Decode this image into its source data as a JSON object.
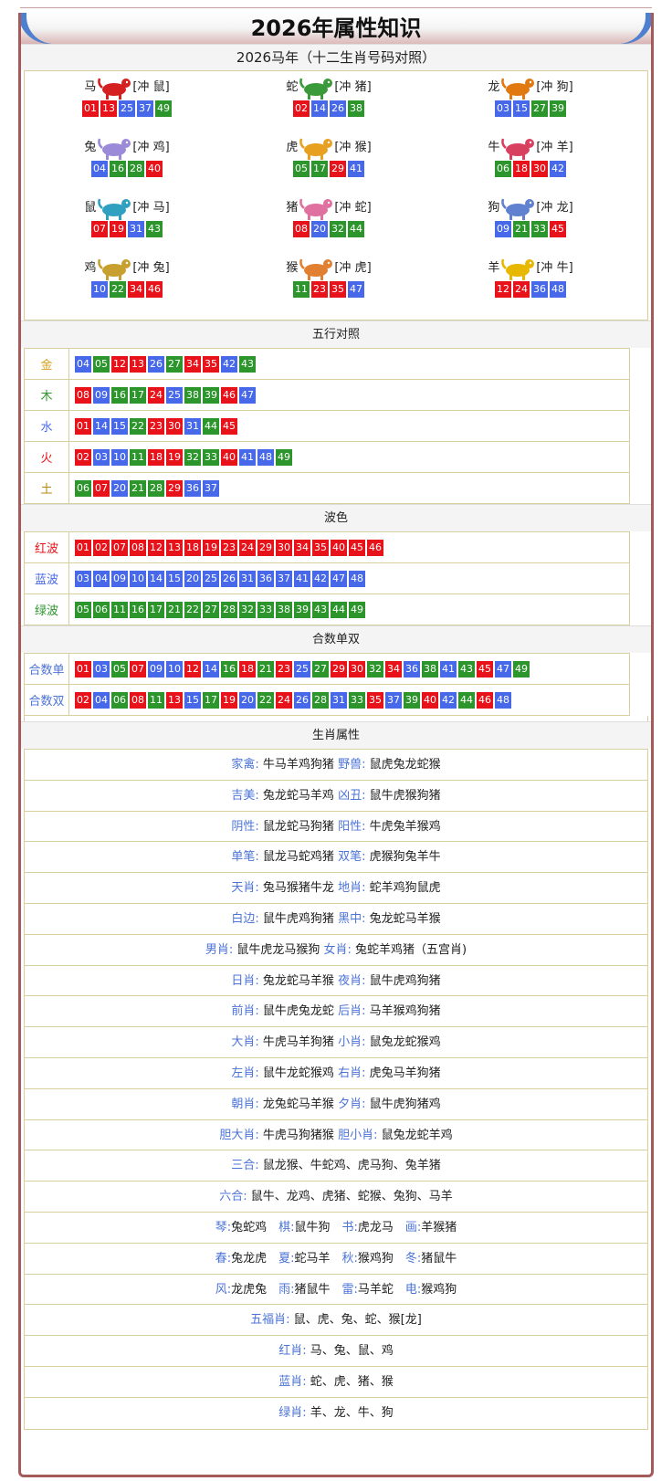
{
  "title": "2026年属性知识",
  "zodiac_section": {
    "heading": "2026马年（十二生肖号码对照）",
    "items": [
      {
        "name": "马",
        "icon": "horse-icon",
        "chong": "[冲 鼠]",
        "nums": [
          [
            "01",
            "red"
          ],
          [
            "13",
            "red"
          ],
          [
            "25",
            "blue"
          ],
          [
            "37",
            "blue"
          ],
          [
            "49",
            "green"
          ]
        ]
      },
      {
        "name": "蛇",
        "icon": "snake-icon",
        "chong": "[冲 猪]",
        "nums": [
          [
            "02",
            "red"
          ],
          [
            "14",
            "blue"
          ],
          [
            "26",
            "blue"
          ],
          [
            "38",
            "green"
          ]
        ]
      },
      {
        "name": "龙",
        "icon": "dragon-icon",
        "chong": "[冲 狗]",
        "nums": [
          [
            "03",
            "blue"
          ],
          [
            "15",
            "blue"
          ],
          [
            "27",
            "green"
          ],
          [
            "39",
            "green"
          ]
        ]
      },
      {
        "name": "兔",
        "icon": "rabbit-icon",
        "chong": "[冲 鸡]",
        "nums": [
          [
            "04",
            "blue"
          ],
          [
            "16",
            "green"
          ],
          [
            "28",
            "green"
          ],
          [
            "40",
            "red"
          ]
        ]
      },
      {
        "name": "虎",
        "icon": "tiger-icon",
        "chong": "[冲 猴]",
        "nums": [
          [
            "05",
            "green"
          ],
          [
            "17",
            "green"
          ],
          [
            "29",
            "red"
          ],
          [
            "41",
            "blue"
          ]
        ]
      },
      {
        "name": "牛",
        "icon": "ox-icon",
        "chong": "[冲 羊]",
        "nums": [
          [
            "06",
            "green"
          ],
          [
            "18",
            "red"
          ],
          [
            "30",
            "red"
          ],
          [
            "42",
            "blue"
          ]
        ]
      },
      {
        "name": "鼠",
        "icon": "rat-icon",
        "chong": "[冲 马]",
        "nums": [
          [
            "07",
            "red"
          ],
          [
            "19",
            "red"
          ],
          [
            "31",
            "blue"
          ],
          [
            "43",
            "green"
          ]
        ]
      },
      {
        "name": "猪",
        "icon": "pig-icon",
        "chong": "[冲 蛇]",
        "nums": [
          [
            "08",
            "red"
          ],
          [
            "20",
            "blue"
          ],
          [
            "32",
            "green"
          ],
          [
            "44",
            "green"
          ]
        ]
      },
      {
        "name": "狗",
        "icon": "dog-icon",
        "chong": "[冲 龙]",
        "nums": [
          [
            "09",
            "blue"
          ],
          [
            "21",
            "green"
          ],
          [
            "33",
            "green"
          ],
          [
            "45",
            "red"
          ]
        ]
      },
      {
        "name": "鸡",
        "icon": "rooster-icon",
        "chong": "[冲 兔]",
        "nums": [
          [
            "10",
            "blue"
          ],
          [
            "22",
            "green"
          ],
          [
            "34",
            "red"
          ],
          [
            "46",
            "red"
          ]
        ]
      },
      {
        "name": "猴",
        "icon": "monkey-icon",
        "chong": "[冲 虎]",
        "nums": [
          [
            "11",
            "green"
          ],
          [
            "23",
            "red"
          ],
          [
            "35",
            "red"
          ],
          [
            "47",
            "blue"
          ]
        ]
      },
      {
        "name": "羊",
        "icon": "goat-icon",
        "chong": "[冲 牛]",
        "nums": [
          [
            "12",
            "red"
          ],
          [
            "24",
            "red"
          ],
          [
            "36",
            "blue"
          ],
          [
            "48",
            "blue"
          ]
        ]
      }
    ]
  },
  "wuxing_section": {
    "heading": "五行对照",
    "rows": [
      {
        "label": "金",
        "color": "#d4a017",
        "nums": [
          [
            "04",
            "blue"
          ],
          [
            "05",
            "green"
          ],
          [
            "12",
            "red"
          ],
          [
            "13",
            "red"
          ],
          [
            "26",
            "blue"
          ],
          [
            "27",
            "green"
          ],
          [
            "34",
            "red"
          ],
          [
            "35",
            "red"
          ],
          [
            "42",
            "blue"
          ],
          [
            "43",
            "green"
          ]
        ]
      },
      {
        "label": "木",
        "color": "#2c952c",
        "nums": [
          [
            "08",
            "red"
          ],
          [
            "09",
            "blue"
          ],
          [
            "16",
            "green"
          ],
          [
            "17",
            "green"
          ],
          [
            "24",
            "red"
          ],
          [
            "25",
            "blue"
          ],
          [
            "38",
            "green"
          ],
          [
            "39",
            "green"
          ],
          [
            "46",
            "red"
          ],
          [
            "47",
            "blue"
          ]
        ]
      },
      {
        "label": "水",
        "color": "#4768e8",
        "nums": [
          [
            "01",
            "red"
          ],
          [
            "14",
            "blue"
          ],
          [
            "15",
            "blue"
          ],
          [
            "22",
            "green"
          ],
          [
            "23",
            "red"
          ],
          [
            "30",
            "red"
          ],
          [
            "31",
            "blue"
          ],
          [
            "44",
            "green"
          ],
          [
            "45",
            "red"
          ]
        ]
      },
      {
        "label": "火",
        "color": "#e8121a",
        "nums": [
          [
            "02",
            "red"
          ],
          [
            "03",
            "blue"
          ],
          [
            "10",
            "blue"
          ],
          [
            "11",
            "green"
          ],
          [
            "18",
            "red"
          ],
          [
            "19",
            "red"
          ],
          [
            "32",
            "green"
          ],
          [
            "33",
            "green"
          ],
          [
            "40",
            "red"
          ],
          [
            "41",
            "blue"
          ],
          [
            "48",
            "blue"
          ],
          [
            "49",
            "green"
          ]
        ]
      },
      {
        "label": "土",
        "color": "#b8860b",
        "nums": [
          [
            "06",
            "green"
          ],
          [
            "07",
            "red"
          ],
          [
            "20",
            "blue"
          ],
          [
            "21",
            "green"
          ],
          [
            "28",
            "green"
          ],
          [
            "29",
            "red"
          ],
          [
            "36",
            "blue"
          ],
          [
            "37",
            "blue"
          ]
        ]
      }
    ]
  },
  "wave_section": {
    "heading": "波色",
    "rows": [
      {
        "label": "红波",
        "color": "#e8121a",
        "nums": [
          [
            "01",
            "red"
          ],
          [
            "02",
            "red"
          ],
          [
            "07",
            "red"
          ],
          [
            "08",
            "red"
          ],
          [
            "12",
            "red"
          ],
          [
            "13",
            "red"
          ],
          [
            "18",
            "red"
          ],
          [
            "19",
            "red"
          ],
          [
            "23",
            "red"
          ],
          [
            "24",
            "red"
          ],
          [
            "29",
            "red"
          ],
          [
            "30",
            "red"
          ],
          [
            "34",
            "red"
          ],
          [
            "35",
            "red"
          ],
          [
            "40",
            "red"
          ],
          [
            "45",
            "red"
          ],
          [
            "46",
            "red"
          ]
        ]
      },
      {
        "label": "蓝波",
        "color": "#4768e8",
        "nums": [
          [
            "03",
            "blue"
          ],
          [
            "04",
            "blue"
          ],
          [
            "09",
            "blue"
          ],
          [
            "10",
            "blue"
          ],
          [
            "14",
            "blue"
          ],
          [
            "15",
            "blue"
          ],
          [
            "20",
            "blue"
          ],
          [
            "25",
            "blue"
          ],
          [
            "26",
            "blue"
          ],
          [
            "31",
            "blue"
          ],
          [
            "36",
            "blue"
          ],
          [
            "37",
            "blue"
          ],
          [
            "41",
            "blue"
          ],
          [
            "42",
            "blue"
          ],
          [
            "47",
            "blue"
          ],
          [
            "48",
            "blue"
          ]
        ]
      },
      {
        "label": "绿波",
        "color": "#2c952c",
        "nums": [
          [
            "05",
            "green"
          ],
          [
            "06",
            "green"
          ],
          [
            "11",
            "green"
          ],
          [
            "16",
            "green"
          ],
          [
            "17",
            "green"
          ],
          [
            "21",
            "green"
          ],
          [
            "22",
            "green"
          ],
          [
            "27",
            "green"
          ],
          [
            "28",
            "green"
          ],
          [
            "32",
            "green"
          ],
          [
            "33",
            "green"
          ],
          [
            "38",
            "green"
          ],
          [
            "39",
            "green"
          ],
          [
            "43",
            "green"
          ],
          [
            "44",
            "green"
          ],
          [
            "49",
            "green"
          ]
        ]
      }
    ]
  },
  "heshu_section": {
    "heading": "合数单双",
    "rows": [
      {
        "label": "合数单",
        "color": "#4b73d8",
        "nums": [
          [
            "01",
            "red"
          ],
          [
            "03",
            "blue"
          ],
          [
            "05",
            "green"
          ],
          [
            "07",
            "red"
          ],
          [
            "09",
            "blue"
          ],
          [
            "10",
            "blue"
          ],
          [
            "12",
            "red"
          ],
          [
            "14",
            "blue"
          ],
          [
            "16",
            "green"
          ],
          [
            "18",
            "red"
          ],
          [
            "21",
            "green"
          ],
          [
            "23",
            "red"
          ],
          [
            "25",
            "blue"
          ],
          [
            "27",
            "green"
          ],
          [
            "29",
            "red"
          ],
          [
            "30",
            "red"
          ],
          [
            "32",
            "green"
          ],
          [
            "34",
            "red"
          ],
          [
            "36",
            "blue"
          ],
          [
            "38",
            "green"
          ],
          [
            "41",
            "blue"
          ],
          [
            "43",
            "green"
          ],
          [
            "45",
            "red"
          ],
          [
            "47",
            "blue"
          ],
          [
            "49",
            "green"
          ]
        ]
      },
      {
        "label": "合数双",
        "color": "#4b73d8",
        "nums": [
          [
            "02",
            "red"
          ],
          [
            "04",
            "blue"
          ],
          [
            "06",
            "green"
          ],
          [
            "08",
            "red"
          ],
          [
            "11",
            "green"
          ],
          [
            "13",
            "red"
          ],
          [
            "15",
            "blue"
          ],
          [
            "17",
            "green"
          ],
          [
            "19",
            "red"
          ],
          [
            "20",
            "blue"
          ],
          [
            "22",
            "green"
          ],
          [
            "24",
            "red"
          ],
          [
            "26",
            "blue"
          ],
          [
            "28",
            "green"
          ],
          [
            "31",
            "blue"
          ],
          [
            "33",
            "green"
          ],
          [
            "35",
            "red"
          ],
          [
            "37",
            "blue"
          ],
          [
            "39",
            "green"
          ],
          [
            "40",
            "red"
          ],
          [
            "42",
            "blue"
          ],
          [
            "44",
            "green"
          ],
          [
            "46",
            "red"
          ],
          [
            "48",
            "blue"
          ]
        ]
      }
    ]
  },
  "attr_section": {
    "heading": "生肖属性",
    "rows": [
      [
        {
          "k": "家禽:",
          "v": " 牛马羊鸡狗猪 "
        },
        {
          "k": "野兽:",
          "v": " 鼠虎兔龙蛇猴"
        }
      ],
      [
        {
          "k": "吉美:",
          "v": " 兔龙蛇马羊鸡 "
        },
        {
          "k": "凶丑:",
          "v": " 鼠牛虎猴狗猪"
        }
      ],
      [
        {
          "k": "阴性:",
          "v": " 鼠龙蛇马狗猪 "
        },
        {
          "k": "阳性:",
          "v": " 牛虎兔羊猴鸡"
        }
      ],
      [
        {
          "k": "单笔:",
          "v": " 鼠龙马蛇鸡猪 "
        },
        {
          "k": "双笔:",
          "v": " 虎猴狗兔羊牛"
        }
      ],
      [
        {
          "k": "天肖:",
          "v": " 兔马猴猪牛龙 "
        },
        {
          "k": "地肖:",
          "v": " 蛇羊鸡狗鼠虎"
        }
      ],
      [
        {
          "k": "白边:",
          "v": " 鼠牛虎鸡狗猪 "
        },
        {
          "k": "黑中:",
          "v": " 兔龙蛇马羊猴"
        }
      ],
      [
        {
          "k": "男肖:",
          "v": " 鼠牛虎龙马猴狗 "
        },
        {
          "k": "女肖:",
          "v": " 兔蛇羊鸡猪（五宫肖)"
        }
      ],
      [
        {
          "k": "日肖:",
          "v": " 兔龙蛇马羊猴 "
        },
        {
          "k": "夜肖:",
          "v": " 鼠牛虎鸡狗猪"
        }
      ],
      [
        {
          "k": "前肖:",
          "v": " 鼠牛虎兔龙蛇 "
        },
        {
          "k": "后肖:",
          "v": " 马羊猴鸡狗猪"
        }
      ],
      [
        {
          "k": "大肖:",
          "v": " 牛虎马羊狗猪 "
        },
        {
          "k": "小肖:",
          "v": " 鼠兔龙蛇猴鸡"
        }
      ],
      [
        {
          "k": "左肖:",
          "v": " 鼠牛龙蛇猴鸡 "
        },
        {
          "k": "右肖:",
          "v": " 虎兔马羊狗猪"
        }
      ],
      [
        {
          "k": "朝肖:",
          "v": " 龙兔蛇马羊猴 "
        },
        {
          "k": "夕肖:",
          "v": " 鼠牛虎狗猪鸡"
        }
      ],
      [
        {
          "k": "胆大肖:",
          "v": " 牛虎马狗猪猴 "
        },
        {
          "k": "胆小肖:",
          "v": " 鼠兔龙蛇羊鸡"
        }
      ],
      [
        {
          "k": "三合:",
          "v": " 鼠龙猴、牛蛇鸡、虎马狗、兔羊猪"
        }
      ],
      [
        {
          "k": "六合:",
          "v": " 鼠牛、龙鸡、虎猪、蛇猴、兔狗、马羊"
        }
      ],
      [
        {
          "k": "琴:",
          "v": "兔蛇鸡　"
        },
        {
          "k": "棋:",
          "v": "鼠牛狗　"
        },
        {
          "k": "书:",
          "v": "虎龙马　"
        },
        {
          "k": "画:",
          "v": "羊猴猪"
        }
      ],
      [
        {
          "k": "春:",
          "v": "兔龙虎　"
        },
        {
          "k": "夏:",
          "v": "蛇马羊　"
        },
        {
          "k": "秋:",
          "v": "猴鸡狗　"
        },
        {
          "k": "冬:",
          "v": "猪鼠牛"
        }
      ],
      [
        {
          "k": "风:",
          "v": "龙虎兔　"
        },
        {
          "k": "雨:",
          "v": "猪鼠牛　"
        },
        {
          "k": "雷:",
          "v": "马羊蛇　"
        },
        {
          "k": "电:",
          "v": "猴鸡狗"
        }
      ],
      [
        {
          "k": "五福肖:",
          "v": " 鼠、虎、兔、蛇、猴[龙]"
        }
      ],
      [
        {
          "k": "红肖:",
          "v": " 马、兔、鼠、鸡"
        }
      ],
      [
        {
          "k": "蓝肖:",
          "v": " 蛇、虎、猪、猴"
        }
      ],
      [
        {
          "k": "绿肖:",
          "v": " 羊、龙、牛、狗"
        }
      ]
    ]
  },
  "colors": {
    "red": "#e8121a",
    "blue": "#4768e8",
    "green": "#2c952c",
    "key": "#4b73d8",
    "border": "#a55a5a"
  }
}
